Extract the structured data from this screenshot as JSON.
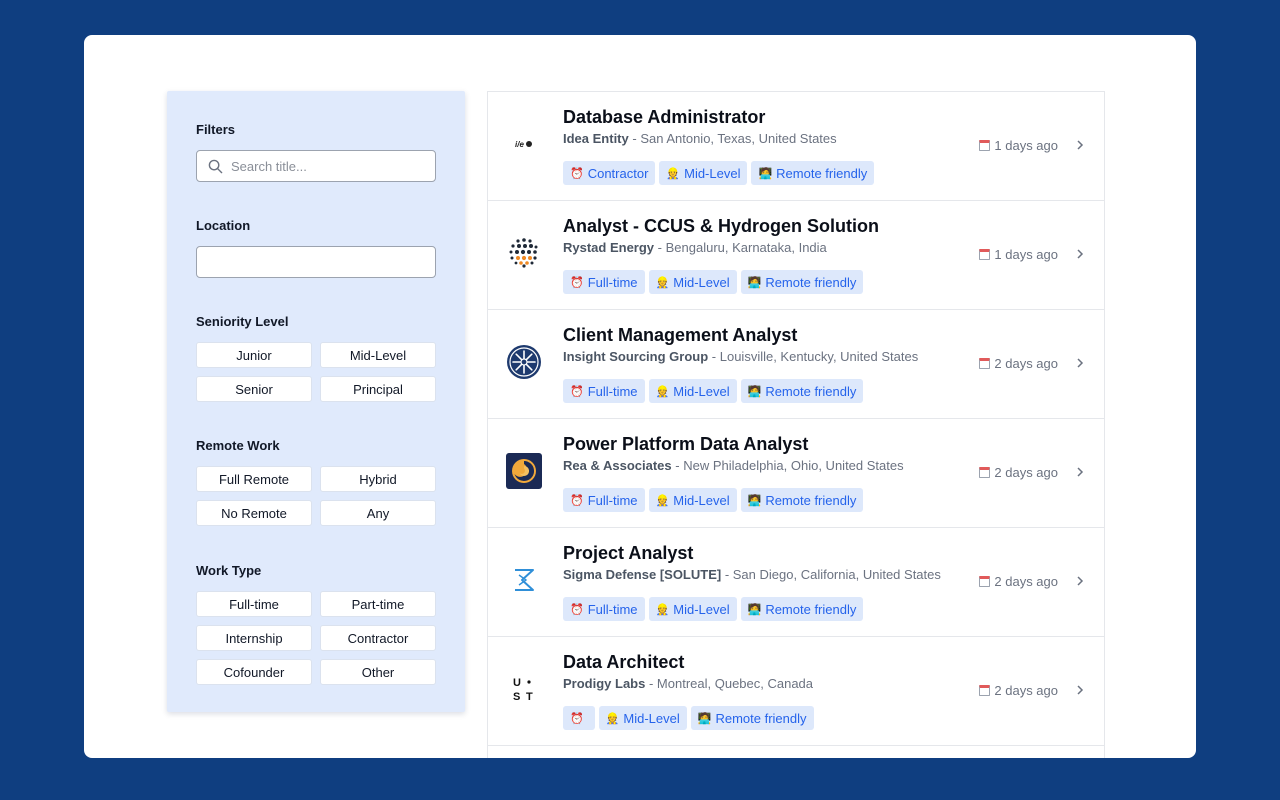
{
  "filters": {
    "filters_title": "Filters",
    "search_placeholder": "Search title...",
    "location_title": "Location",
    "location_value": "",
    "seniority_title": "Seniority Level",
    "seniority_options": [
      "Junior",
      "Mid-Level",
      "Senior",
      "Principal"
    ],
    "remote_title": "Remote Work",
    "remote_options": [
      "Full Remote",
      "Hybrid",
      "No Remote",
      "Any"
    ],
    "worktype_title": "Work Type",
    "worktype_options": [
      "Full-time",
      "Part-time",
      "Internship",
      "Contractor",
      "Cofounder",
      "Other"
    ]
  },
  "jobs": [
    {
      "title": "Database Administrator",
      "company": "Idea Entity",
      "location": "San Antonio, Texas, United States",
      "tags": [
        {
          "icon": "alarm-clock-icon",
          "label": "Contractor"
        },
        {
          "icon": "hard-hat-icon",
          "label": "Mid-Level"
        },
        {
          "icon": "remote-worker-icon",
          "label": "Remote friendly"
        }
      ],
      "posted": "1 days ago",
      "logo": "idea-entity-logo"
    },
    {
      "title": "Analyst - CCUS & Hydrogen Solution",
      "company": "Rystad Energy",
      "location": "Bengaluru, Karnataka, India",
      "tags": [
        {
          "icon": "alarm-clock-icon",
          "label": "Full-time"
        },
        {
          "icon": "hard-hat-icon",
          "label": "Mid-Level"
        },
        {
          "icon": "remote-worker-icon",
          "label": "Remote friendly"
        }
      ],
      "posted": "1 days ago",
      "logo": "rystad-energy-logo"
    },
    {
      "title": "Client Management Analyst",
      "company": "Insight Sourcing Group",
      "location": "Louisville, Kentucky, United States",
      "tags": [
        {
          "icon": "alarm-clock-icon",
          "label": "Full-time"
        },
        {
          "icon": "hard-hat-icon",
          "label": "Mid-Level"
        },
        {
          "icon": "remote-worker-icon",
          "label": "Remote friendly"
        }
      ],
      "posted": "2 days ago",
      "logo": "insight-sourcing-logo"
    },
    {
      "title": "Power Platform Data Analyst",
      "company": "Rea & Associates",
      "location": "New Philadelphia, Ohio, United States",
      "tags": [
        {
          "icon": "alarm-clock-icon",
          "label": "Full-time"
        },
        {
          "icon": "hard-hat-icon",
          "label": "Mid-Level"
        },
        {
          "icon": "remote-worker-icon",
          "label": "Remote friendly"
        }
      ],
      "posted": "2 days ago",
      "logo": "rea-associates-logo"
    },
    {
      "title": "Project Analyst",
      "company": "Sigma Defense [SOLUTE]",
      "location": "San Diego, California, United States",
      "tags": [
        {
          "icon": "alarm-clock-icon",
          "label": "Full-time"
        },
        {
          "icon": "hard-hat-icon",
          "label": "Mid-Level"
        },
        {
          "icon": "remote-worker-icon",
          "label": "Remote friendly"
        }
      ],
      "posted": "2 days ago",
      "logo": "sigma-defense-logo"
    },
    {
      "title": "Data Architect",
      "company": "Prodigy Labs",
      "location": "Montreal, Quebec, Canada",
      "tags": [
        {
          "icon": "alarm-clock-icon",
          "label": ""
        },
        {
          "icon": "hard-hat-icon",
          "label": "Mid-Level"
        },
        {
          "icon": "remote-worker-icon",
          "label": "Remote friendly"
        }
      ],
      "posted": "2 days ago",
      "logo": "ust-logo",
      "logo_text": "U·\nST"
    }
  ],
  "colors": {
    "background": "#0f3e80",
    "sidebar": "#e0eafc",
    "tag_bg": "#dde8fb",
    "tag_text": "#2563eb"
  }
}
